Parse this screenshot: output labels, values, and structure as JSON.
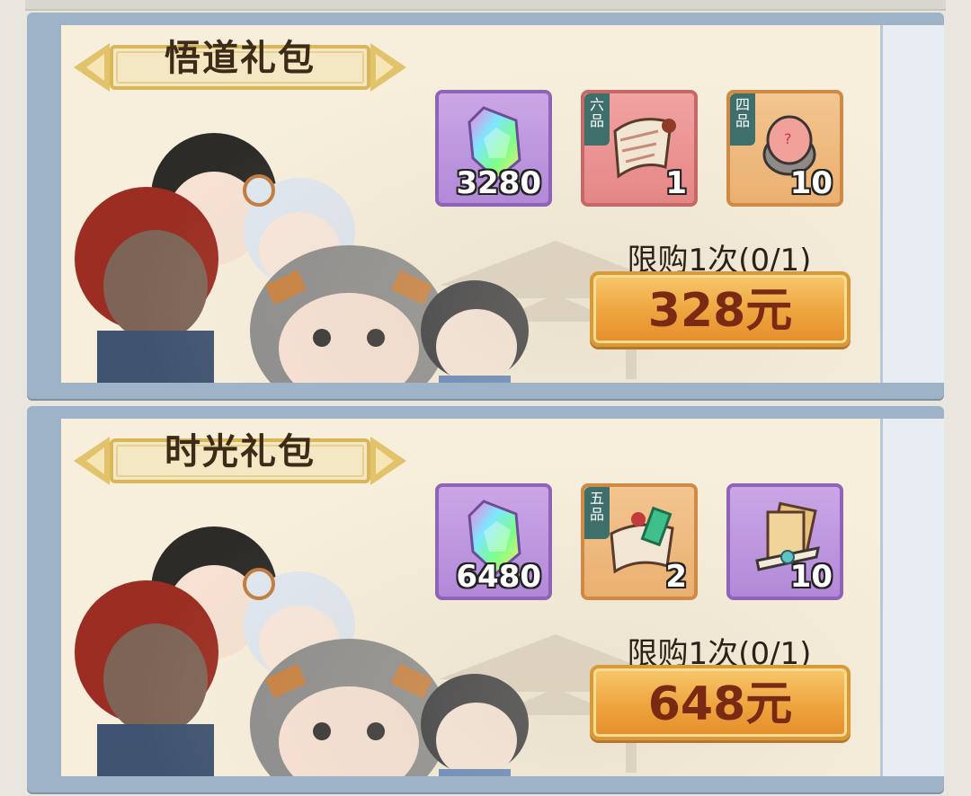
{
  "packs": [
    {
      "title": "悟道礼包",
      "items": [
        {
          "icon": "rainbow-crystal-icon",
          "quantity": "3280",
          "frame": "purple",
          "grade": ""
        },
        {
          "icon": "scroll-icon",
          "quantity": "1",
          "frame": "red",
          "grade": "六品"
        },
        {
          "icon": "red-stone-icon",
          "quantity": "10",
          "frame": "orange",
          "grade": "四品"
        }
      ],
      "limit_text": "限购1次(0/1)",
      "price_label": "328元"
    },
    {
      "title": "时光礼包",
      "items": [
        {
          "icon": "rainbow-crystal-icon",
          "quantity": "6480",
          "frame": "purple",
          "grade": ""
        },
        {
          "icon": "map-scroll-icon",
          "quantity": "2",
          "frame": "orange",
          "grade": "五品"
        },
        {
          "icon": "card-pack-icon",
          "quantity": "10",
          "frame": "purple",
          "grade": ""
        }
      ],
      "limit_text": "限购1次(0/1)",
      "price_label": "648元"
    }
  ],
  "colors": {
    "card_frame": "#9fb3c8",
    "card_bg": "#f7efdc",
    "button_gold": "#eea43e",
    "price_text": "#7a2a12"
  }
}
